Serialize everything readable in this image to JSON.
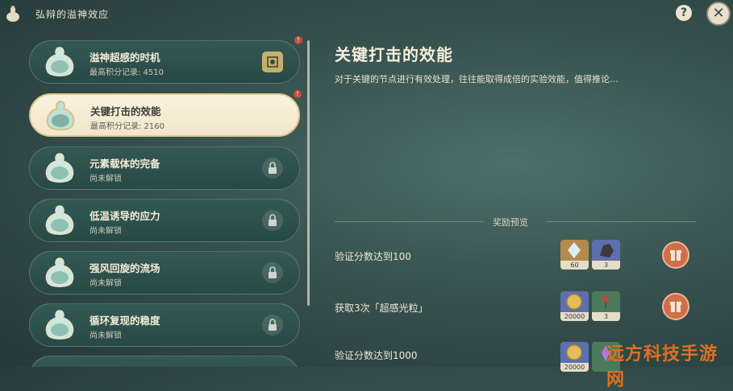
{
  "window": {
    "title": "弘辩的溢神效应",
    "help_label": "?",
    "close_label": "✕"
  },
  "challenges": [
    {
      "title": "溢神超感的时机",
      "subtitle": "最高积分记录: 4510",
      "state": "completed",
      "has_badge": true
    },
    {
      "title": "关键打击的效能",
      "subtitle": "最高积分记录: 2160",
      "state": "selected",
      "has_badge": true
    },
    {
      "title": "元素载体的完备",
      "subtitle": "尚未解锁",
      "state": "locked",
      "has_badge": false
    },
    {
      "title": "低温诱导的应力",
      "subtitle": "尚未解锁",
      "state": "locked",
      "has_badge": false
    },
    {
      "title": "强风回旋的流场",
      "subtitle": "尚未解锁",
      "state": "locked",
      "has_badge": false
    },
    {
      "title": "循环复现的稳度",
      "subtitle": "尚未解锁",
      "state": "locked",
      "has_badge": false
    }
  ],
  "detail": {
    "title": "关键打击的效能",
    "description": "对于关键的节点进行有效处理，往往能取得成倍的实验效能，值得推论…"
  },
  "rewards": {
    "header": "奖励预览",
    "rows": [
      {
        "text": "验证分数达到100",
        "items": [
          {
            "icon": "crystal-icon",
            "qty": "60"
          },
          {
            "icon": "ore-icon",
            "qty": "3"
          }
        ]
      },
      {
        "text": "获取3次「超感光粒」",
        "items": [
          {
            "icon": "mora-coin-icon",
            "qty": "20000"
          },
          {
            "icon": "flower-material-icon",
            "qty": "3"
          }
        ]
      },
      {
        "text": "验证分数达到1000",
        "items": [
          {
            "icon": "mora-coin-icon",
            "qty": "20000"
          },
          {
            "icon": "purple-crystal-icon",
            "qty": ""
          }
        ]
      }
    ]
  },
  "watermark": "远方科技手游网"
}
